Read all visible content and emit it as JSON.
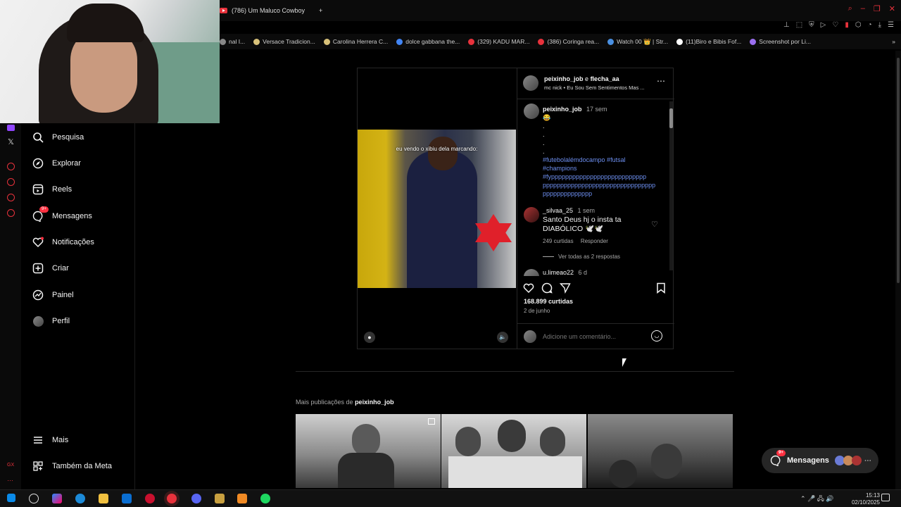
{
  "browser": {
    "tab_title": "(786) Um Maluco Cowboy",
    "new_tab": "+",
    "bookmarks": [
      {
        "label": "nal I...",
        "color": "#888888"
      },
      {
        "label": "Versace Tradicion...",
        "color": "#d9c27a"
      },
      {
        "label": "Carolina Herrera C...",
        "color": "#d9c27a"
      },
      {
        "label": "dolce gabbana the...",
        "color": "#4285f4"
      },
      {
        "label": "(329) KADU MAR...",
        "color": "#e8323c"
      },
      {
        "label": "(386) Coringa rea...",
        "color": "#e8323c"
      },
      {
        "label": "Watch 00 👑 | Str...",
        "color": "#4a90e2"
      },
      {
        "label": "(11)Biro e Bibis Fof...",
        "color": "#ffffff"
      },
      {
        "label": "Screenshot por Li...",
        "color": "#9b6ff0"
      }
    ]
  },
  "sidebar": {
    "items": [
      {
        "label": "Pesquisa",
        "icon": "search-icon"
      },
      {
        "label": "Explorar",
        "icon": "compass-icon"
      },
      {
        "label": "Reels",
        "icon": "reels-icon"
      },
      {
        "label": "Mensagens",
        "icon": "messenger-icon",
        "badge": "9+"
      },
      {
        "label": "Notificações",
        "icon": "heart-icon"
      },
      {
        "label": "Criar",
        "icon": "plus-square-icon"
      },
      {
        "label": "Painel",
        "icon": "dashboard-icon"
      },
      {
        "label": "Perfil",
        "icon": "avatar"
      }
    ],
    "more": "Mais",
    "meta": "Também da Meta"
  },
  "post": {
    "video_caption": "eu vendo o xibiu dela marcando:",
    "author": "peixinho_job",
    "author_joiner": "e",
    "coauthor": "flecha_aa",
    "audio": "mc nick • Eu Sou Sem Sentimentos Mas ...",
    "caption_author": "peixinho_job",
    "caption_time": "17 sem",
    "caption_emoji": "😂",
    "caption_dots": [
      ".",
      ".",
      ".",
      "."
    ],
    "hashtags_line1": "#futebolalémdocampo #futsal",
    "hashtags_line2": "#champions",
    "hashtags_line3": "#fyppppppppppppppppppppppppppp",
    "hashtags_line4": "pppppppppppppppppppppppppppppppp",
    "hashtags_line5": "pppppppppppppp",
    "comment_user": "_silvaa_25",
    "comment_time": "1 sem",
    "comment_text": "Santo Deus hj o insta ta DIABÓLICO 🕊️🕊️",
    "comment_likes": "249 curtidas",
    "comment_reply": "Responder",
    "view_replies": "Ver todas as 2 respostas",
    "next_comment_user": "u.limeao22",
    "next_comment_time": "6 d",
    "likes": "168.899 curtidas",
    "date": "2 de junho",
    "add_comment_placeholder": "Adicione um comentário..."
  },
  "more_posts": {
    "prefix": "Mais publicações de",
    "user": "peixinho_job"
  },
  "messages_pill": {
    "label": "Mensagens",
    "badge": "9+"
  },
  "taskbar": {
    "time": "15:13",
    "date": "02/10/2025"
  }
}
